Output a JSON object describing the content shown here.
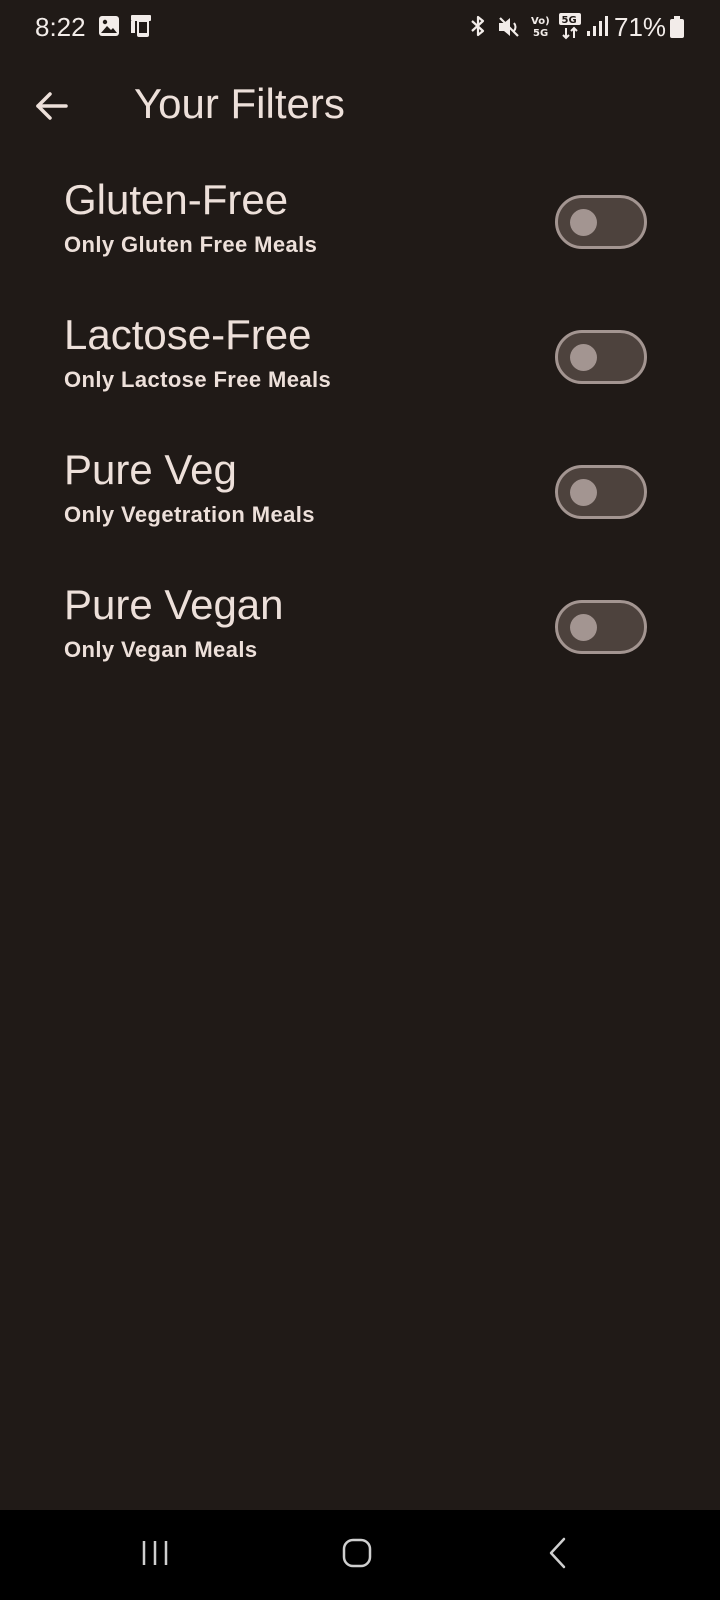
{
  "status_bar": {
    "time": "8:22",
    "battery": "71%",
    "icons": [
      "gallery-icon",
      "device-icon",
      "bluetooth-icon",
      "mute-icon",
      "volte-icon",
      "5g-icon",
      "signal-icon",
      "battery-icon"
    ]
  },
  "app_bar": {
    "title": "Your Filters",
    "back_icon": "arrow-left-icon"
  },
  "filters": [
    {
      "title": "Gluten-Free",
      "subtitle": "Only Gluten Free Meals",
      "enabled": false
    },
    {
      "title": "Lactose-Free",
      "subtitle": "Only Lactose Free Meals",
      "enabled": false
    },
    {
      "title": "Pure Veg",
      "subtitle": "Only Vegetration Meals",
      "enabled": false
    },
    {
      "title": "Pure Vegan",
      "subtitle": "Only Vegan Meals",
      "enabled": false
    }
  ],
  "nav_bar": {
    "icons": [
      "recents-icon",
      "home-icon",
      "back-icon"
    ]
  },
  "colors": {
    "background": "#201a17",
    "text": "#ede0da",
    "switch_track": "#4d423d",
    "switch_outline": "#a39591",
    "nav_background": "#000000"
  }
}
